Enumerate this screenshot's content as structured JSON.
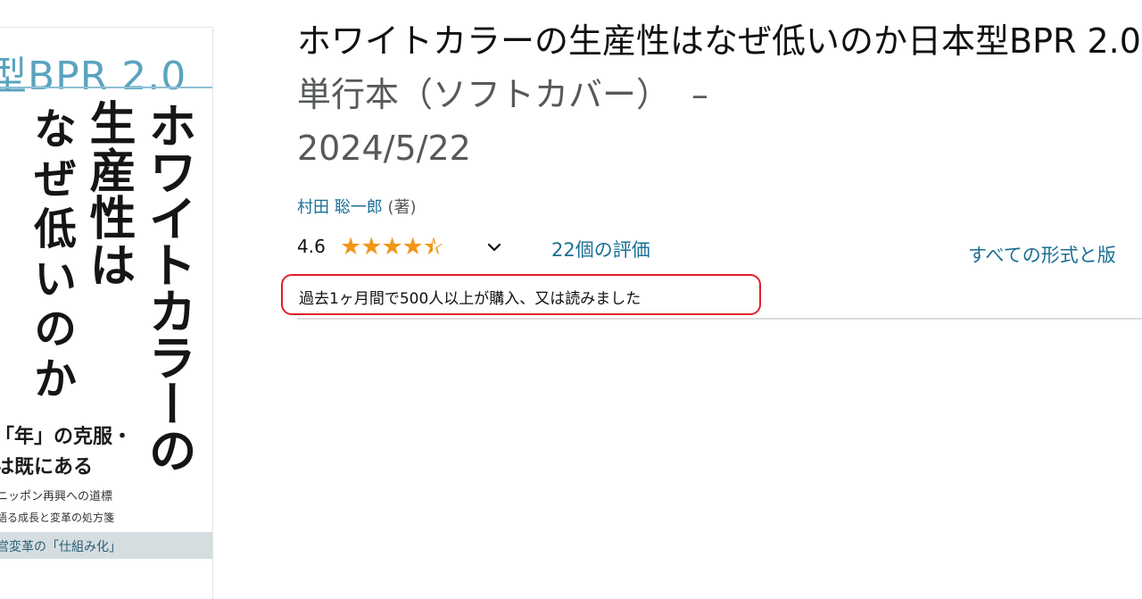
{
  "cover": {
    "subtitle": "型BPR 2.0",
    "vertical_lines": [
      "ホワイトカラーの",
      "生産性は",
      "なぜ低いのか"
    ],
    "tagline_1": "「年」の克服・",
    "tagline_2": "は既にある",
    "tagline_3": "ニッポン再興への道標",
    "tagline_4": "語る成長と変革の処方箋",
    "band_text": "営変革の「仕組み化」"
  },
  "product": {
    "title": "ホワイトカラーの生産性はなぜ低いのか日本型BPR 2.0",
    "format": "単行本（ソフトカバー）",
    "separator": "–",
    "date": "2024/5/22",
    "author": "村田 聡一郎",
    "author_role": "(著)",
    "rating_value": "4.6",
    "rating_stars": 4.5,
    "reviews_count": "22個の評価",
    "all_formats_link": "すべての形式と版",
    "purchase_note": "過去1ヶ月間で500人以上が購入、又は読みました"
  },
  "colors": {
    "link": "#1a6f95",
    "star": "#f0971a",
    "highlight_border": "#e0202c",
    "muted_text": "#565959"
  },
  "icons": {
    "star": "star-icon",
    "chevron": "chevron-down-icon"
  }
}
